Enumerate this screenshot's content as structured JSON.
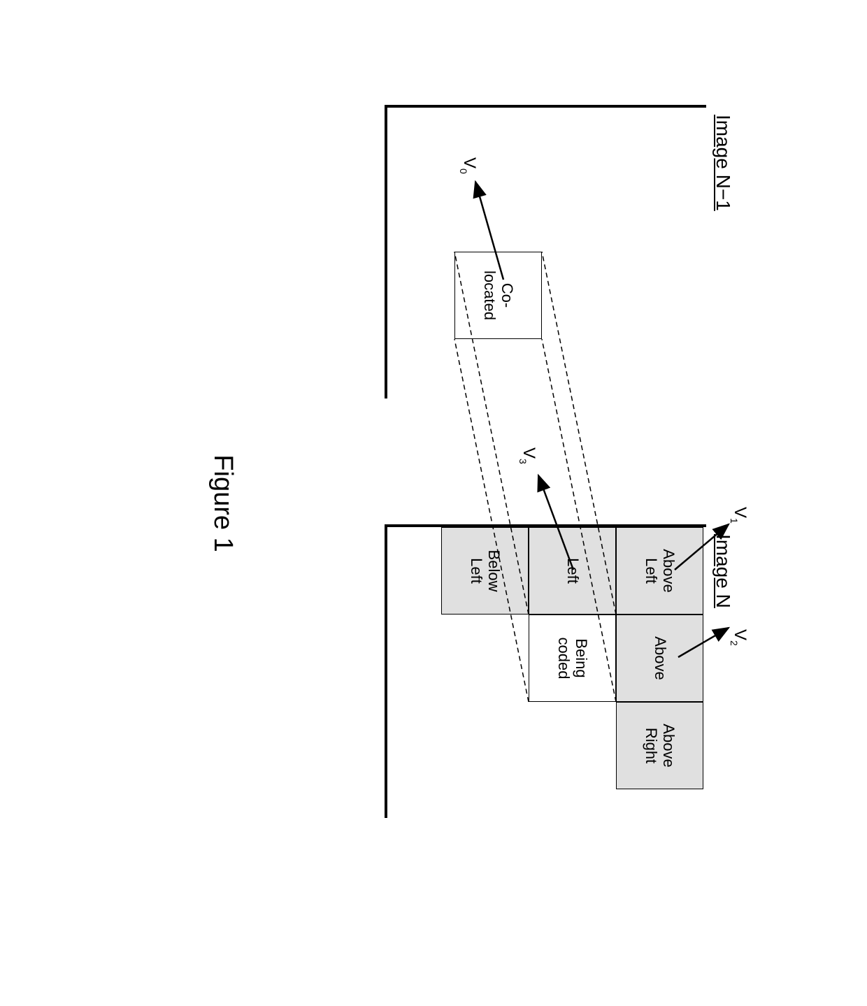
{
  "figure_label": "Figure 1",
  "frames": {
    "n1": {
      "label": "Image N−1"
    },
    "n": {
      "label": "Image N"
    }
  },
  "blocks": {
    "colocated": "Co-\nlocated",
    "above_left": "Above\nLeft",
    "above": "Above",
    "above_right": "Above\nRight",
    "left": "Left",
    "being_coded": "Being\ncoded",
    "below_left": "Below\nLeft"
  },
  "vectors": {
    "v0": {
      "label": "V",
      "sub": "0"
    },
    "v1": {
      "label": "V",
      "sub": "1"
    },
    "v2": {
      "label": "V",
      "sub": "2"
    },
    "v3": {
      "label": "V",
      "sub": "3"
    }
  },
  "chart_data": {
    "type": "table",
    "description": "Motion vector predictor candidates diagram",
    "frames": [
      {
        "name": "Image N−1",
        "blocks": [
          {
            "name": "Co-located",
            "vector": "V0",
            "position": "temporal"
          }
        ]
      },
      {
        "name": "Image N",
        "blocks": [
          {
            "name": "Above Left",
            "vector": "V1",
            "position": "top-left",
            "shaded": true
          },
          {
            "name": "Above",
            "vector": "V2",
            "position": "top",
            "shaded": true
          },
          {
            "name": "Above Right",
            "position": "top-right",
            "shaded": true
          },
          {
            "name": "Left",
            "vector": "V3",
            "position": "left",
            "shaded": true
          },
          {
            "name": "Being coded",
            "position": "center",
            "shaded": false
          },
          {
            "name": "Below Left",
            "position": "bottom-left",
            "shaded": true
          }
        ]
      }
    ]
  }
}
